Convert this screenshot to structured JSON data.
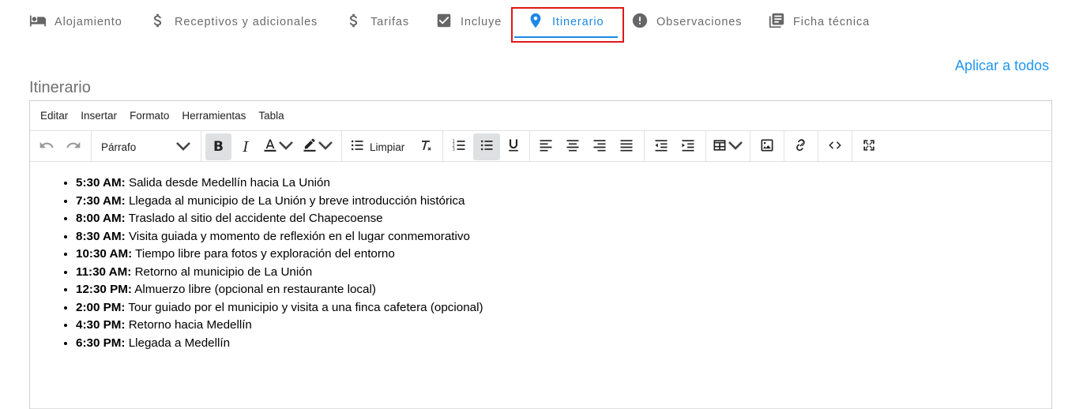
{
  "tabs": [
    {
      "label": "Alojamiento",
      "icon": "bed-icon"
    },
    {
      "label": "Receptivos y adicionales",
      "icon": "dollar-icon"
    },
    {
      "label": "Tarifas",
      "icon": "dollar-icon"
    },
    {
      "label": "Incluye",
      "icon": "checkbox-icon"
    },
    {
      "label": "Itinerario",
      "icon": "location-pin-icon",
      "active": true
    },
    {
      "label": "Observaciones",
      "icon": "alert-circle-icon"
    },
    {
      "label": "Ficha técnica",
      "icon": "document-list-icon"
    }
  ],
  "apply_all_label": "Aplicar a todos",
  "section_title": "Itinerario",
  "editor": {
    "menu": [
      "Editar",
      "Insertar",
      "Formato",
      "Herramientas",
      "Tabla"
    ],
    "toolbar": {
      "block_format": "Párrafo",
      "clear_label": "Limpiar"
    },
    "items": [
      {
        "time": "5:30 AM:",
        "text": " Salida desde Medellín hacia La Unión"
      },
      {
        "time": "7:30 AM:",
        "text": " Llegada al municipio de La Unión y breve introducción histórica"
      },
      {
        "time": "8:00 AM:",
        "text": " Traslado al sitio del accidente del Chapecoense"
      },
      {
        "time": "8:30 AM:",
        "text": " Visita guiada y momento de reflexión en el lugar conmemorativo"
      },
      {
        "time": "10:30 AM:",
        "text": " Tiempo libre para fotos y exploración del entorno"
      },
      {
        "time": "11:30 AM:",
        "text": " Retorno al municipio de La Unión"
      },
      {
        "time": "12:30 PM:",
        "text": " Almuerzo libre (opcional en restaurante local)"
      },
      {
        "time": "2:00 PM:",
        "text": " Tour guiado por el municipio y visita a una finca cafetera (opcional)"
      },
      {
        "time": "4:30 PM:",
        "text": " Retorno hacia Medellín"
      },
      {
        "time": "6:30 PM:",
        "text": " Llegada a Medellín"
      }
    ]
  },
  "colors": {
    "accent": "#1e88e5",
    "highlight_border": "#e01818",
    "link": "#2196f3"
  }
}
